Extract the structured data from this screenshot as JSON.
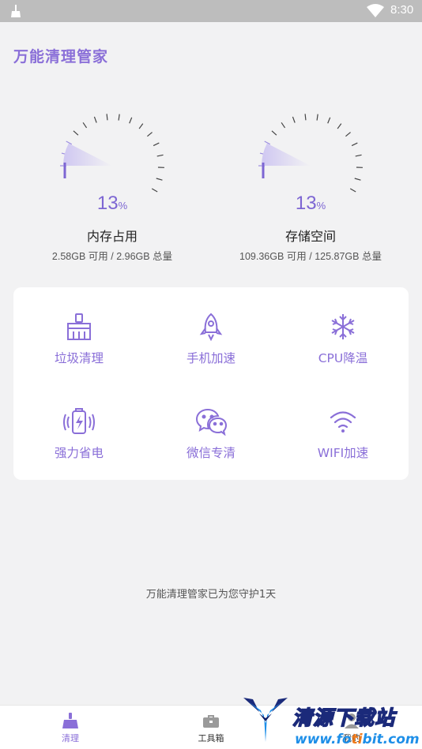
{
  "status_bar": {
    "time": "8:30"
  },
  "app": {
    "title": "万能清理管家"
  },
  "gauges": [
    {
      "percent": "13",
      "percent_unit": "%",
      "label": "内存占用",
      "detail": "2.58GB 可用 / 2.96GB 总量",
      "value": 0.13
    },
    {
      "percent": "13",
      "percent_unit": "%",
      "label": "存储空间",
      "detail": "109.36GB 可用 / 125.87GB 总量",
      "value": 0.13
    }
  ],
  "tools": [
    {
      "label": "垃圾清理",
      "icon": "broom-icon"
    },
    {
      "label": "手机加速",
      "icon": "rocket-icon"
    },
    {
      "label": "CPU降温",
      "icon": "snowflake-icon"
    },
    {
      "label": "强力省电",
      "icon": "battery-icon"
    },
    {
      "label": "微信专清",
      "icon": "wechat-icon"
    },
    {
      "label": "WIFI加速",
      "icon": "wifi-icon"
    }
  ],
  "guard_text": "万能清理管家已为您守护1天",
  "bottom_nav": [
    {
      "label": "清理",
      "icon": "broom-icon",
      "active": true
    },
    {
      "label": "工具箱",
      "icon": "toolbox-icon",
      "active": false
    },
    {
      "label": "我的",
      "icon": "user-icon",
      "active": false
    }
  ],
  "watermark": {
    "title": "清源下载站",
    "url_a": "www.fo",
    "url_b": "ti",
    "url_c": "bit.com"
  },
  "colors": {
    "accent": "#8a6fd8",
    "percent": "#7d66d3",
    "background": "#f2f2f3",
    "status_bar": "#bdbdbd"
  }
}
